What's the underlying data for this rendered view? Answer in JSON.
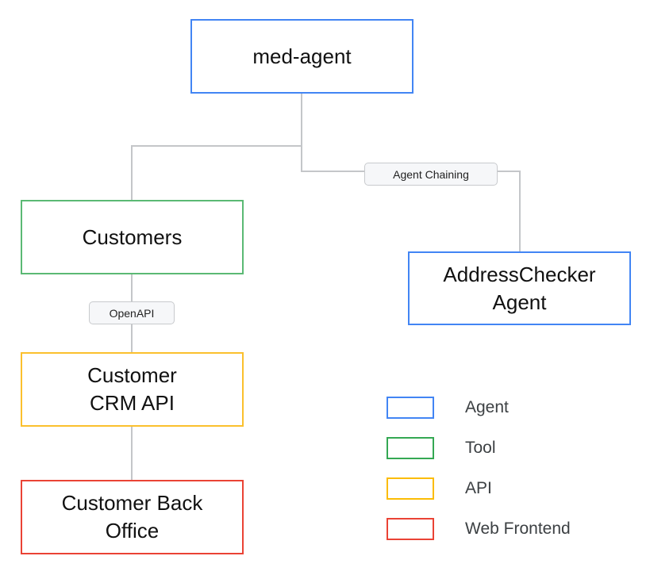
{
  "nodes": {
    "med_agent": {
      "label": "med-agent",
      "type": "Agent"
    },
    "customers": {
      "label": "Customers",
      "type": "Tool"
    },
    "address_checker": {
      "label": "AddressChecker Agent",
      "type": "Agent"
    },
    "crm_api": {
      "label": "Customer CRM API",
      "type": "API"
    },
    "back_office": {
      "label": "Customer Back Office",
      "type": "Web Frontend"
    }
  },
  "edges": {
    "agent_chaining": "Agent Chaining",
    "openapi": "OpenAPI"
  },
  "legend": [
    {
      "label": "Agent",
      "color": "#4285f4"
    },
    {
      "label": "Tool",
      "color": "#34a853"
    },
    {
      "label": "API",
      "color": "#fbbc04"
    },
    {
      "label": "Web Frontend",
      "color": "#ea4335"
    }
  ],
  "colors": {
    "line": "#c4c6c9"
  }
}
